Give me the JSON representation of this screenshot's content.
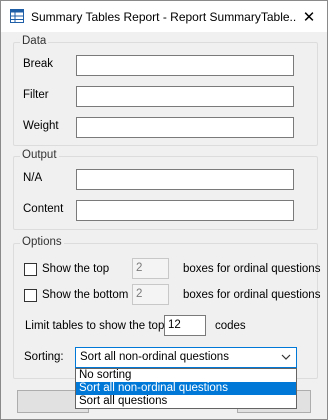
{
  "window": {
    "title": "Summary Tables Report - Report SummaryTable...",
    "close_symbol": "✕"
  },
  "data_group": {
    "label": "Data",
    "break_label": "Break",
    "filter_label": "Filter",
    "weight_label": "Weight",
    "break_value": "",
    "filter_value": "",
    "weight_value": ""
  },
  "output_group": {
    "label": "Output",
    "na_label": "N/A",
    "content_label": "Content",
    "na_value": "",
    "content_value": ""
  },
  "options_group": {
    "label": "Options",
    "show_top_label": "Show the top",
    "show_top_value": "2",
    "show_top_suffix": "boxes for ordinal questions",
    "show_bottom_label": "Show the bottom",
    "show_bottom_value": "2",
    "show_bottom_suffix": "boxes for ordinal questions",
    "limit_label": "Limit tables to show the top",
    "limit_value": "12",
    "limit_suffix": "codes",
    "sorting_label": "Sorting:",
    "sorting_selected": "Sort all non-ordinal questions",
    "sorting_options": [
      "No sorting",
      "Sort all non-ordinal questions",
      "Sort all questions"
    ]
  },
  "colors": {
    "accent": "#0078d7",
    "window_bg": "#f0f0f0"
  }
}
